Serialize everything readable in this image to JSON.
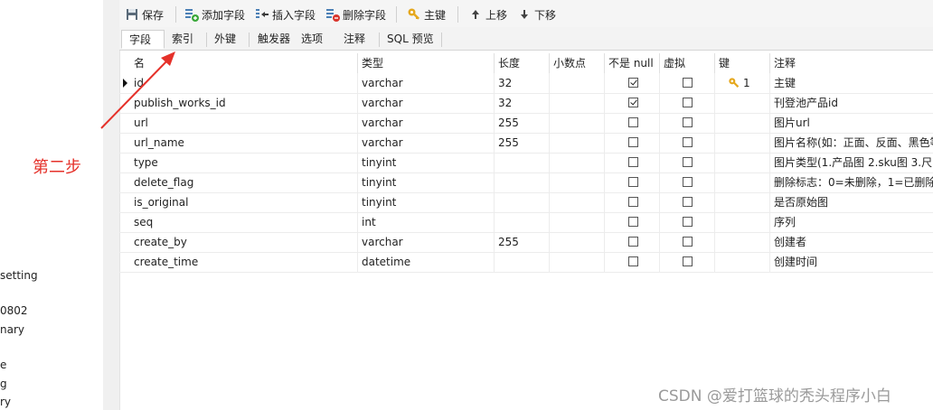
{
  "left_pane": {
    "fragments": [
      "setting",
      "0802",
      "nary",
      "e",
      "g",
      "ry"
    ]
  },
  "annotation": {
    "step_label": "第二步",
    "color": "#e5312a"
  },
  "toolbar": {
    "save": "保存",
    "add_field": "添加字段",
    "insert_field": "插入字段",
    "delete_field": "删除字段",
    "primary_key": "主键",
    "move_up": "上移",
    "move_down": "下移"
  },
  "tabs": [
    "字段",
    "索引",
    "外键",
    "触发器",
    "选项",
    "注释",
    "SQL 预览"
  ],
  "active_tab": "字段",
  "columns": [
    "名",
    "类型",
    "长度",
    "小数点",
    "不是 null",
    "虚拟",
    "键",
    "注释"
  ],
  "rows": [
    {
      "name": "id",
      "type": "varchar",
      "length": "32",
      "decimal": "",
      "not_null": true,
      "virtual": false,
      "key": "1",
      "comment": "主键"
    },
    {
      "name": "publish_works_id",
      "type": "varchar",
      "length": "32",
      "decimal": "",
      "not_null": true,
      "virtual": false,
      "key": "",
      "comment": "刊登池产品id"
    },
    {
      "name": "url",
      "type": "varchar",
      "length": "255",
      "decimal": "",
      "not_null": false,
      "virtual": false,
      "key": "",
      "comment": "图片url"
    },
    {
      "name": "url_name",
      "type": "varchar",
      "length": "255",
      "decimal": "",
      "not_null": false,
      "virtual": false,
      "key": "",
      "comment": "图片名称(如：正面、反面、黑色等"
    },
    {
      "name": "type",
      "type": "tinyint",
      "length": "",
      "decimal": "",
      "not_null": false,
      "virtual": false,
      "key": "",
      "comment": "图片类型(1.产品图  2.sku图  3.尺"
    },
    {
      "name": "delete_flag",
      "type": "tinyint",
      "length": "",
      "decimal": "",
      "not_null": false,
      "virtual": false,
      "key": "",
      "comment": "删除标志：0=未删除，1=已删除"
    },
    {
      "name": "is_original",
      "type": "tinyint",
      "length": "",
      "decimal": "",
      "not_null": false,
      "virtual": false,
      "key": "",
      "comment": "是否原始图"
    },
    {
      "name": "seq",
      "type": "int",
      "length": "",
      "decimal": "",
      "not_null": false,
      "virtual": false,
      "key": "",
      "comment": "序列"
    },
    {
      "name": "create_by",
      "type": "varchar",
      "length": "255",
      "decimal": "",
      "not_null": false,
      "virtual": false,
      "key": "",
      "comment": "创建者"
    },
    {
      "name": "create_time",
      "type": "datetime",
      "length": "",
      "decimal": "",
      "not_null": false,
      "virtual": false,
      "key": "",
      "comment": "创建时间"
    }
  ],
  "watermark": "CSDN @爱打篮球的秃头程序小白"
}
